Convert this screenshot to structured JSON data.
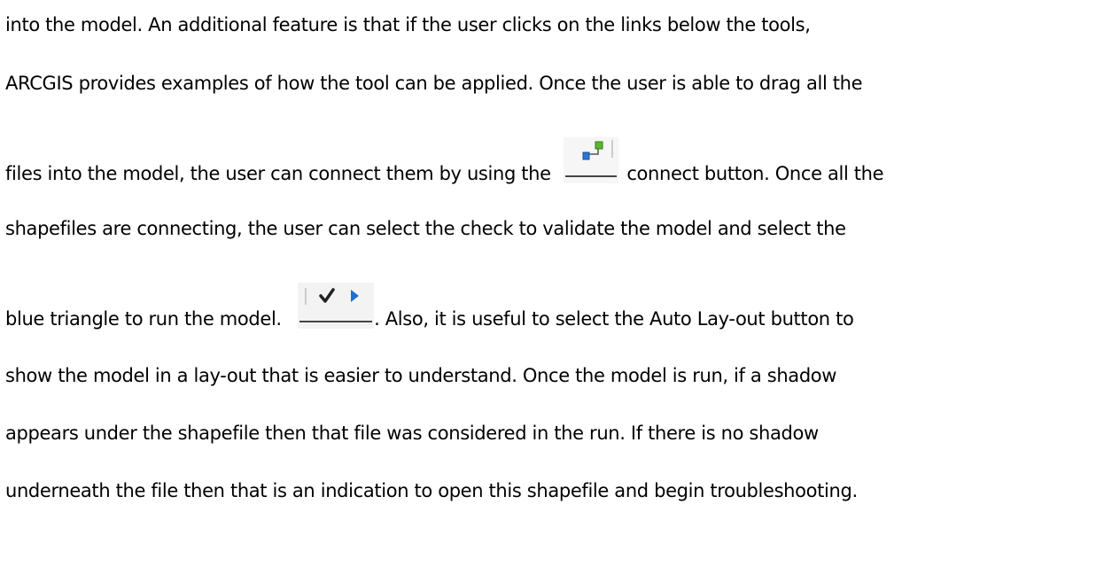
{
  "document": {
    "lines": [
      "into the model. An additional feature is that if the user clicks on the links below the tools,",
      "ARCGIS provides examples of how the tool can be applied. Once the user is able to drag all the",
      "files into the model, the user can connect them by using the",
      "connect button. Once all the",
      "shapefiles are connecting, the user can select the check to validate the model and select the",
      "blue triangle to run the model.",
      ". Also, it is useful to select the Auto Lay-out button to",
      "show the model in a lay-out that is easier to understand. Once the model is run, if a shadow",
      "appears under the shapefile then that file was considered in the run. If there is no shadow",
      "underneath the file then that is an indication to open this shapefile and begin troubleshooting."
    ],
    "icons": {
      "connect": "connect-tool-icon",
      "validate": "validate-check-icon",
      "run": "run-triangle-icon"
    },
    "colors": {
      "connect_green": "#5cb82a",
      "connect_blue": "#2a78d4",
      "check": "#222222",
      "run_blue": "#1f6fd0"
    }
  }
}
